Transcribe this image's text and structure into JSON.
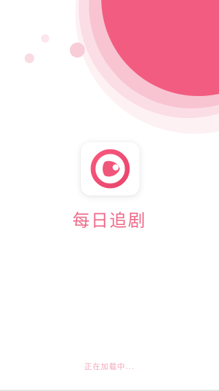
{
  "splash": {
    "app_name": "每日追剧",
    "loading_text": "正在加载中..."
  },
  "icons": {
    "logo": "play-ring-icon"
  },
  "colors": {
    "primary": "#f0557a",
    "primary_light": "#f7b6c5",
    "primary_pale": "#fce3ea",
    "text_accent": "#ef6b89",
    "loading_text": "#f2a7b8",
    "background": "#ffffff"
  }
}
